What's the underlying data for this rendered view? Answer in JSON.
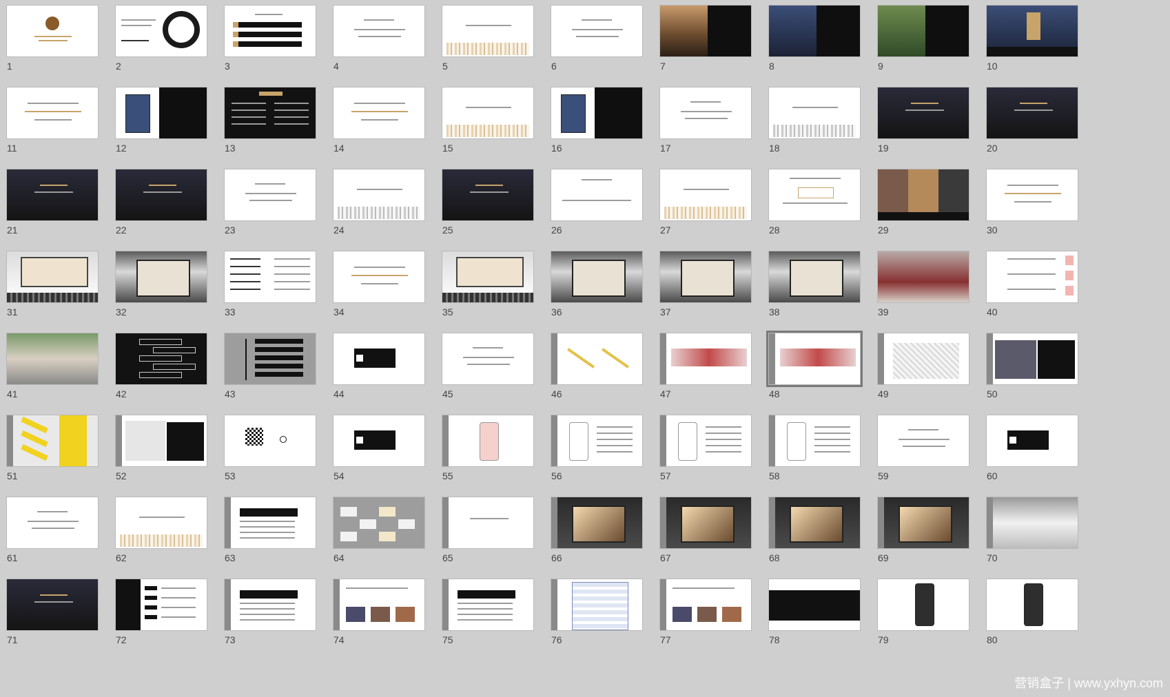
{
  "slides": [
    {
      "n": "1",
      "v": "logo"
    },
    {
      "n": "2",
      "v": "ink"
    },
    {
      "n": "3",
      "v": "list"
    },
    {
      "n": "4",
      "v": "text"
    },
    {
      "n": "5",
      "v": "gold"
    },
    {
      "n": "6",
      "v": "text"
    },
    {
      "n": "7",
      "v": "photo-split-warm"
    },
    {
      "n": "8",
      "v": "photo-split-city"
    },
    {
      "n": "9",
      "v": "photo-split-green"
    },
    {
      "n": "10",
      "v": "photo-city"
    },
    {
      "n": "11",
      "v": "text-gold"
    },
    {
      "n": "12",
      "v": "magazine"
    },
    {
      "n": "13",
      "v": "dark"
    },
    {
      "n": "14",
      "v": "text-gold"
    },
    {
      "n": "15",
      "v": "gold"
    },
    {
      "n": "16",
      "v": "magazine"
    },
    {
      "n": "17",
      "v": "text"
    },
    {
      "n": "18",
      "v": "gray-city"
    },
    {
      "n": "19",
      "v": "photo-night"
    },
    {
      "n": "20",
      "v": "photo-night"
    },
    {
      "n": "21",
      "v": "photo-night"
    },
    {
      "n": "22",
      "v": "photo-night"
    },
    {
      "n": "23",
      "v": "text"
    },
    {
      "n": "24",
      "v": "gray-city"
    },
    {
      "n": "25",
      "v": "photo-night"
    },
    {
      "n": "26",
      "v": "diagram"
    },
    {
      "n": "27",
      "v": "gold"
    },
    {
      "n": "28",
      "v": "box"
    },
    {
      "n": "29",
      "v": "photos"
    },
    {
      "n": "30",
      "v": "text-gold"
    },
    {
      "n": "31",
      "v": "billboard"
    },
    {
      "n": "32",
      "v": "subway"
    },
    {
      "n": "33",
      "v": "tree"
    },
    {
      "n": "34",
      "v": "text-gold"
    },
    {
      "n": "35",
      "v": "billboard"
    },
    {
      "n": "36",
      "v": "subway"
    },
    {
      "n": "37",
      "v": "subway"
    },
    {
      "n": "38",
      "v": "subway"
    },
    {
      "n": "39",
      "v": "red"
    },
    {
      "n": "40",
      "v": "panels"
    },
    {
      "n": "41",
      "v": "street"
    },
    {
      "n": "42",
      "v": "dark-tree"
    },
    {
      "n": "43",
      "v": "gray-tree"
    },
    {
      "n": "44",
      "v": "blackbox"
    },
    {
      "n": "45",
      "v": "text"
    },
    {
      "n": "46",
      "v": "pencils"
    },
    {
      "n": "47",
      "v": "red-side"
    },
    {
      "n": "48",
      "v": "red-side"
    },
    {
      "n": "49",
      "v": "map"
    },
    {
      "n": "50",
      "v": "photo-black"
    },
    {
      "n": "51",
      "v": "yellow"
    },
    {
      "n": "52",
      "v": "people"
    },
    {
      "n": "53",
      "v": "qr"
    },
    {
      "n": "54",
      "v": "blackbox"
    },
    {
      "n": "55",
      "v": "phone"
    },
    {
      "n": "56",
      "v": "phone-text"
    },
    {
      "n": "57",
      "v": "phone-text"
    },
    {
      "n": "58",
      "v": "phone-text"
    },
    {
      "n": "59",
      "v": "text"
    },
    {
      "n": "60",
      "v": "blackbox"
    },
    {
      "n": "61",
      "v": "text"
    },
    {
      "n": "62",
      "v": "gold"
    },
    {
      "n": "63",
      "v": "side-list"
    },
    {
      "n": "64",
      "v": "gray-grid"
    },
    {
      "n": "65",
      "v": "side-text"
    },
    {
      "n": "66",
      "v": "screen"
    },
    {
      "n": "67",
      "v": "screen"
    },
    {
      "n": "68",
      "v": "screen"
    },
    {
      "n": "69",
      "v": "screen"
    },
    {
      "n": "70",
      "v": "gallery"
    },
    {
      "n": "71",
      "v": "photo-night"
    },
    {
      "n": "72",
      "v": "dark-timeline"
    },
    {
      "n": "73",
      "v": "side-list"
    },
    {
      "n": "74",
      "v": "side-photos"
    },
    {
      "n": "75",
      "v": "side-list"
    },
    {
      "n": "76",
      "v": "web"
    },
    {
      "n": "77",
      "v": "side-photos"
    },
    {
      "n": "78",
      "v": "dark-bar"
    },
    {
      "n": "79",
      "v": "phone-dark"
    },
    {
      "n": "80",
      "v": "phone-dark"
    }
  ],
  "selected": "48",
  "watermark": "营销盒子 | www.yxhyn.com"
}
